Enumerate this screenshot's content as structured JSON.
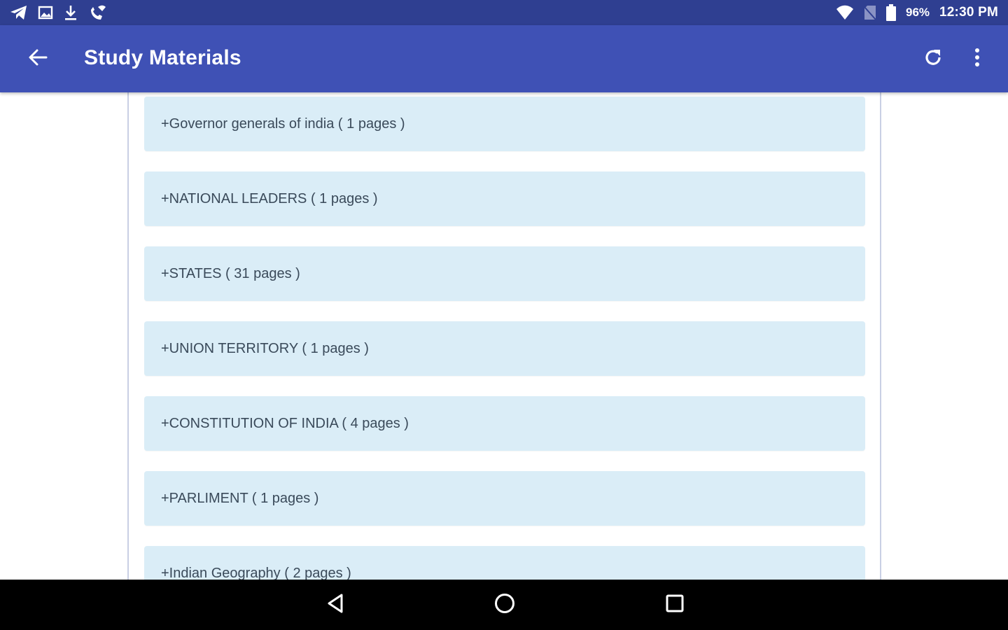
{
  "status_bar": {
    "battery_percent": "96%",
    "time": "12:30 PM",
    "icons_left": [
      "telegram-icon",
      "image-icon",
      "download-icon",
      "phone-wifi-icon"
    ],
    "icons_right": [
      "wifi-icon",
      "no-sim-icon",
      "battery-icon"
    ]
  },
  "app_bar": {
    "title": "Study Materials",
    "back_icon": "arrow-left-icon",
    "refresh_icon": "refresh-icon",
    "menu_icon": "more-vert-icon",
    "color": "#3f51b5"
  },
  "list": {
    "items": [
      "+Governor generals of india ( 1 pages )",
      "+NATIONAL LEADERS ( 1 pages )",
      "+STATES ( 31 pages )",
      "+UNION TERRITORY ( 1 pages )",
      "+CONSTITUTION OF INDIA ( 4 pages )",
      "+PARLIMENT ( 1 pages )",
      "+Indian Geography ( 2 pages )"
    ],
    "item_background": "#daedf7"
  },
  "nav_bar": {
    "buttons": [
      "nav-back-icon",
      "nav-home-icon",
      "nav-recents-icon"
    ]
  }
}
